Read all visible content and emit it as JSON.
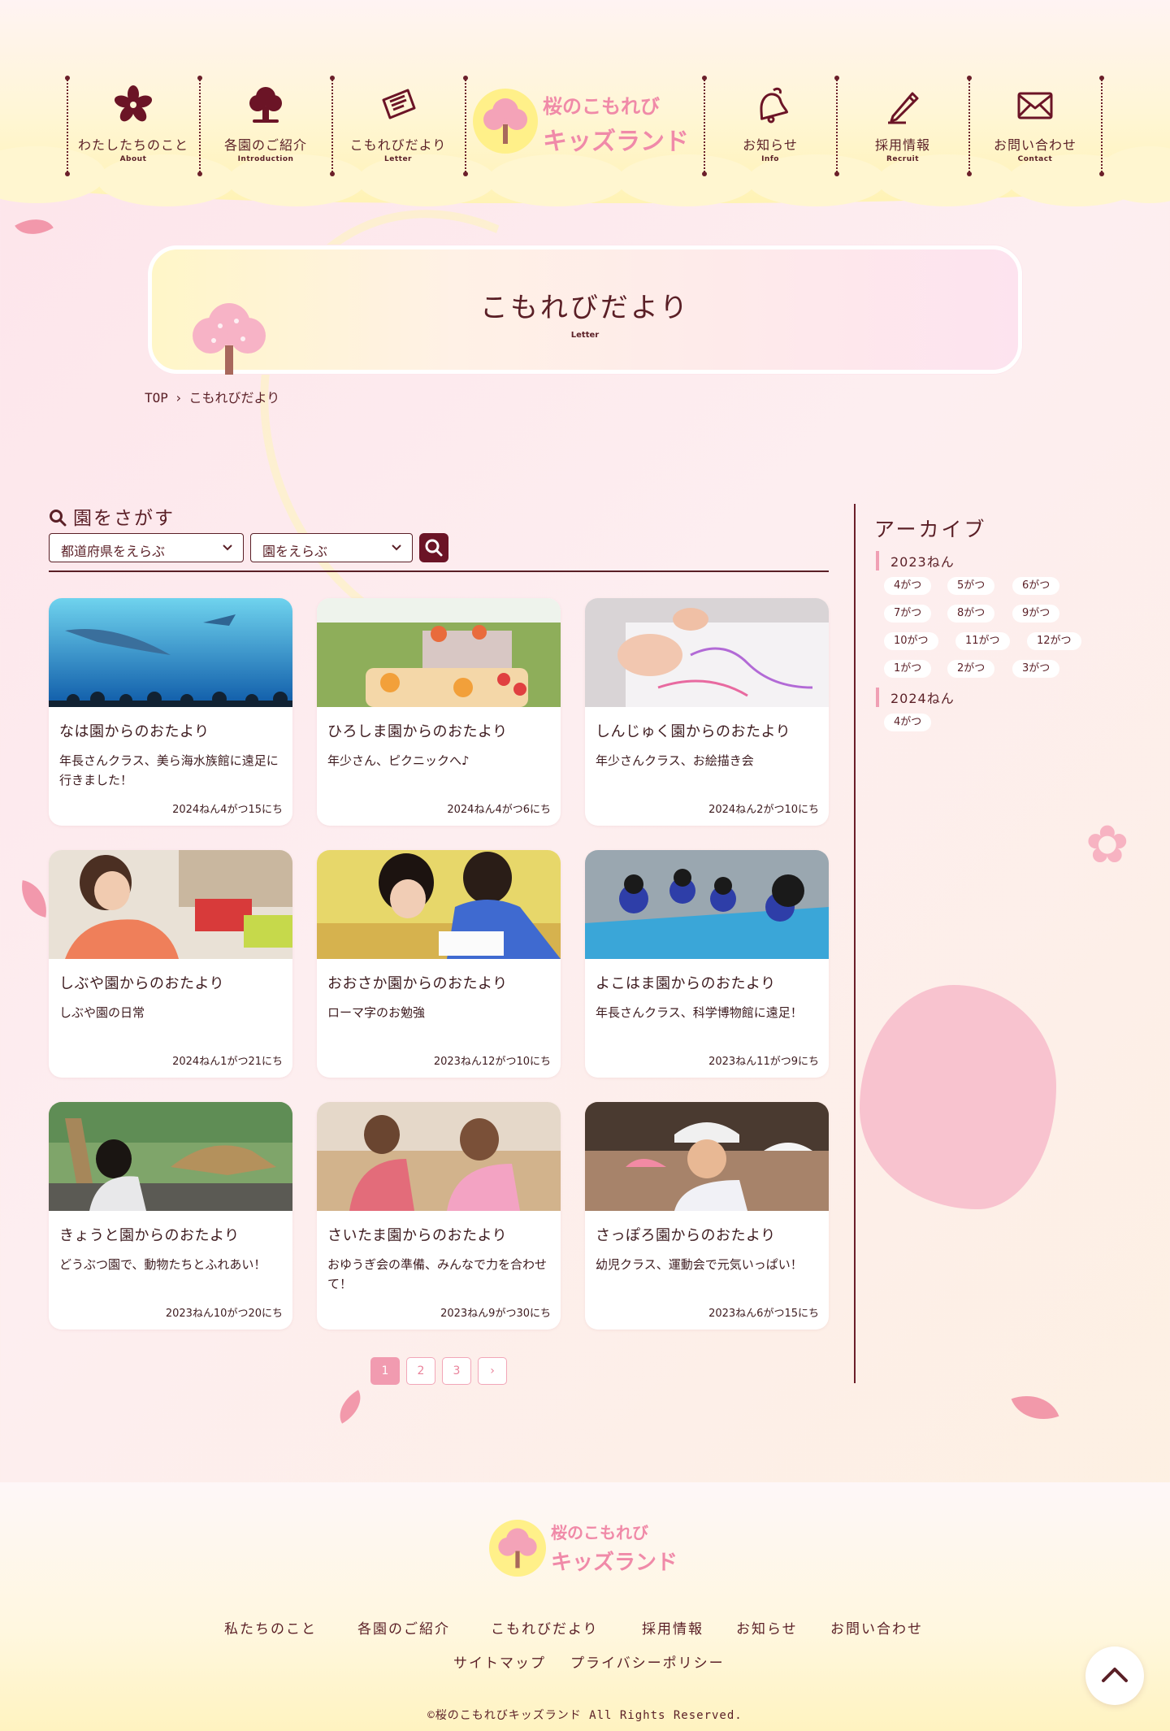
{
  "site": {
    "logo_line1": "桜のこもれび",
    "logo_line2": "キッズランド"
  },
  "nav": [
    {
      "label": "わたしたちのこと",
      "sub": "About",
      "icon": "sakura-icon"
    },
    {
      "label": "各園のご紹介",
      "sub": "Introduction",
      "icon": "tree-icon"
    },
    {
      "label": "こもれびだより",
      "sub": "Letter",
      "icon": "letter-icon"
    },
    {
      "label": "お知らせ",
      "sub": "Info",
      "icon": "bell-icon"
    },
    {
      "label": "採用情報",
      "sub": "Recruit",
      "icon": "pen-icon"
    },
    {
      "label": "お問い合わせ",
      "sub": "Contact",
      "icon": "mail-icon"
    }
  ],
  "page": {
    "title": "こもれびだより",
    "subtitle": "Letter"
  },
  "breadcrumb": {
    "home": "TOP",
    "current": "こもれびだより"
  },
  "search": {
    "heading": "園をさがす",
    "prefecture_select": "都道府県をえらぶ",
    "school_select": "園をえらぶ"
  },
  "cards": [
    {
      "title": "なは園からのおたより",
      "desc": "年長さんクラス、美ら海水族館に遠足に行きました！",
      "date": "2024ねん4がつ15にち"
    },
    {
      "title": "ひろしま園からのおたより",
      "desc": "年少さん、ピクニックへ♪",
      "date": "2024ねん4がつ6にち"
    },
    {
      "title": "しんじゅく園からのおたより",
      "desc": "年少さんクラス、お絵描き会",
      "date": "2024ねん2がつ10にち"
    },
    {
      "title": "しぶや園からのおたより",
      "desc": "しぶや園の日常",
      "date": "2024ねん1がつ21にち"
    },
    {
      "title": "おおさか園からのおたより",
      "desc": "ローマ字のお勉強",
      "date": "2023ねん12がつ10にち"
    },
    {
      "title": "よこはま園からのおたより",
      "desc": "年長さんクラス、科学博物館に遠足！",
      "date": "2023ねん11がつ9にち"
    },
    {
      "title": "きょうと園からのおたより",
      "desc": "どうぶつ園で、動物たちとふれあい！",
      "date": "2023ねん10がつ20にち"
    },
    {
      "title": "さいたま園からのおたより",
      "desc": "おゆうぎ会の準備、みんなで力を合わせて！",
      "date": "2023ねん9がつ30にち"
    },
    {
      "title": "さっぽろ園からのおたより",
      "desc": "幼児クラス、運動会で元気いっぱい！",
      "date": "2023ねん6がつ15にち"
    }
  ],
  "pagination": [
    "1",
    "2",
    "3",
    "›"
  ],
  "archive": {
    "title": "アーカイブ",
    "years": [
      {
        "year": "2023ねん",
        "months": [
          "4がつ",
          "5がつ",
          "6がつ",
          "7がつ",
          "8がつ",
          "9がつ",
          "10がつ",
          "11がつ",
          "12がつ",
          "1がつ",
          "2がつ",
          "3がつ"
        ]
      },
      {
        "year": "2024ねん",
        "months": [
          "4がつ"
        ]
      }
    ]
  },
  "footer": {
    "links": [
      "私たちのこと",
      "各園のご紹介",
      "こもれびだより",
      "採用情報",
      "お知らせ",
      "お問い合わせ"
    ],
    "links2": [
      "サイトマップ",
      "プライバシーポリシー"
    ],
    "copyright": "©桜のこもれびキッズランド All Rights Reserved."
  },
  "colors": {
    "brand_text": "#5a1f26",
    "accent_pink": "#f19bb0",
    "search_button": "#6b1426",
    "logo_pink": "#f08aa8",
    "logo_yellow": "#fff089"
  }
}
